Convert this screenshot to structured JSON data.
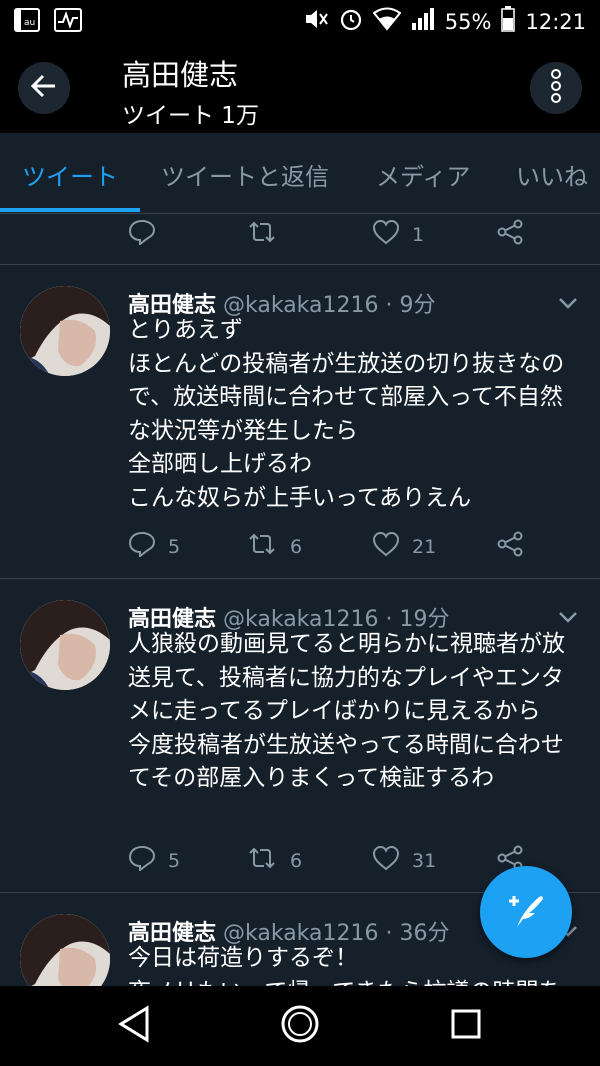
{
  "status_bar": {
    "battery_percent": "55%",
    "time": "12:21",
    "icons": [
      "au-sim-icon",
      "activity-icon",
      "mute-icon",
      "alarm-icon",
      "wifi-icon",
      "signal-icon",
      "battery-icon"
    ]
  },
  "header": {
    "title": "高田健志",
    "subtitle": "ツイート 1万",
    "back_icon": "back-arrow-icon",
    "more_icon": "more-vertical-icon"
  },
  "tabs": [
    {
      "label": "ツイート",
      "active": true
    },
    {
      "label": "ツイートと返信",
      "active": false
    },
    {
      "label": "メディア",
      "active": false
    },
    {
      "label": "いいね",
      "active": false
    }
  ],
  "top_partial_actions": {
    "reply": "",
    "retweet": "",
    "like": "1"
  },
  "tweets": [
    {
      "name": "高田健志",
      "meta": "@kakaka1216 · 9分",
      "text": "とりあえず\nほとんどの投稿者が生放送の切り抜きなので、放送時間に合わせて部屋入って不自然な状況等が発生したら\n全部晒し上げるわ\nこんな奴らが上手いってありえん",
      "reply": "5",
      "retweet": "6",
      "like": "21"
    },
    {
      "name": "高田健志",
      "meta": "@kakaka1216 · 19分",
      "text": "人狼殺の動画見てると明らかに視聴者が放送見て、投稿者に協力的なプレイやエンタメに走ってるプレイばかりに見えるから\n今度投稿者が生放送やってる時間に合わせてその部屋入りまくって検証するわ",
      "reply": "5",
      "retweet": "6",
      "like": "31"
    },
    {
      "name": "高田健志",
      "meta": "@kakaka1216 · 36分",
      "text": "今日は荷造りするぞ！\n夜ノリもいって帰ってきたら抗議の時間を",
      "reply": "",
      "retweet": "",
      "like": ""
    }
  ],
  "colors": {
    "background": "#15202b",
    "accent": "#1da1f2",
    "secondary_text": "#8899a6",
    "divider": "#38444d"
  }
}
